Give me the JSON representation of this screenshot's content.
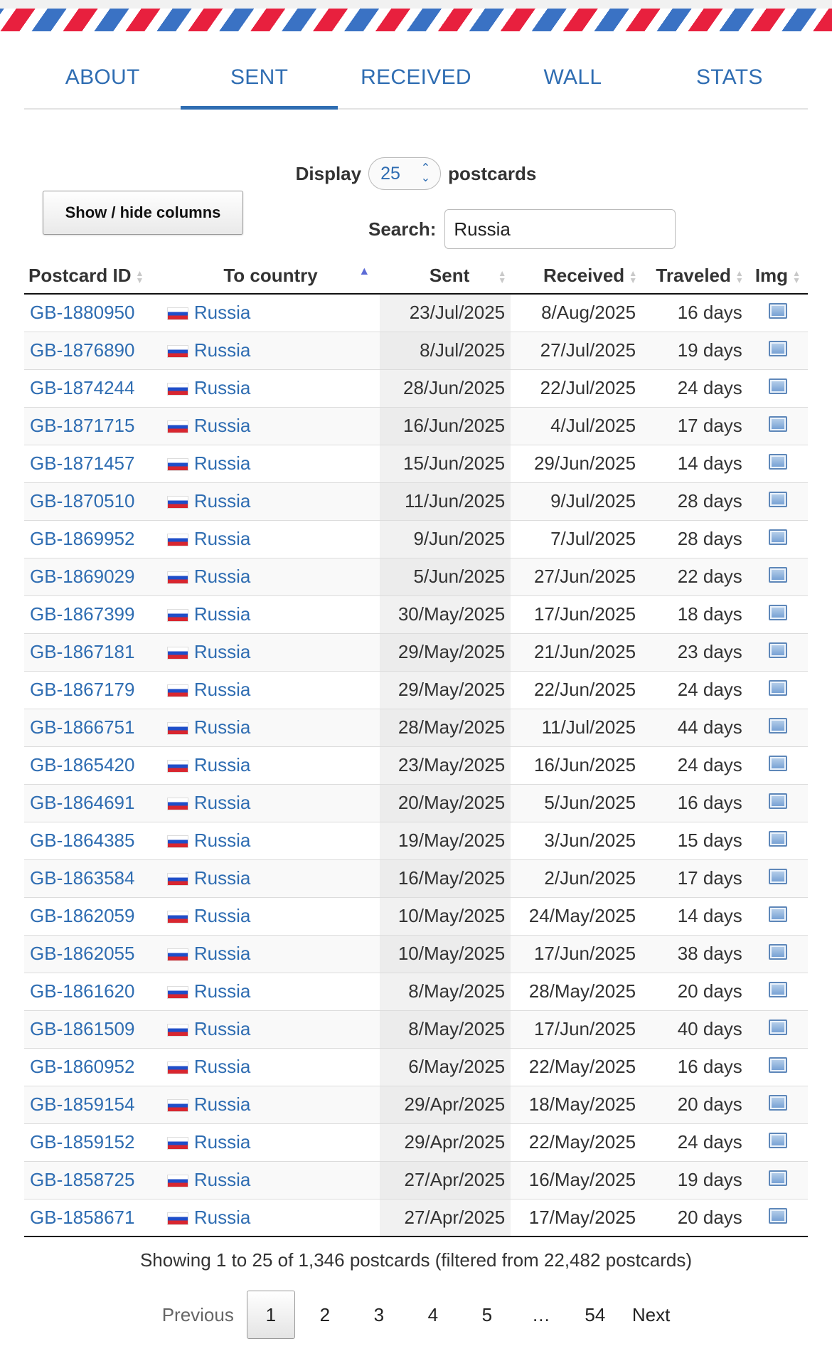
{
  "tabs": [
    {
      "label": "ABOUT"
    },
    {
      "label": "SENT"
    },
    {
      "label": "RECEIVED"
    },
    {
      "label": "WALL"
    },
    {
      "label": "STATS"
    }
  ],
  "display": {
    "prefix": "Display",
    "value": "25",
    "suffix": "postcards"
  },
  "columns_button": "Show / hide columns",
  "search": {
    "label": "Search:",
    "value": "Russia"
  },
  "table": {
    "headers": [
      "Postcard ID",
      "To country",
      "Sent",
      "Received",
      "Traveled",
      "Img"
    ],
    "rows": [
      {
        "id": "GB-1880950",
        "country": "Russia",
        "sent": "23/Jul/2025",
        "received": "8/Aug/2025",
        "traveled": "16 days"
      },
      {
        "id": "GB-1876890",
        "country": "Russia",
        "sent": "8/Jul/2025",
        "received": "27/Jul/2025",
        "traveled": "19 days"
      },
      {
        "id": "GB-1874244",
        "country": "Russia",
        "sent": "28/Jun/2025",
        "received": "22/Jul/2025",
        "traveled": "24 days"
      },
      {
        "id": "GB-1871715",
        "country": "Russia",
        "sent": "16/Jun/2025",
        "received": "4/Jul/2025",
        "traveled": "17 days"
      },
      {
        "id": "GB-1871457",
        "country": "Russia",
        "sent": "15/Jun/2025",
        "received": "29/Jun/2025",
        "traveled": "14 days"
      },
      {
        "id": "GB-1870510",
        "country": "Russia",
        "sent": "11/Jun/2025",
        "received": "9/Jul/2025",
        "traveled": "28 days"
      },
      {
        "id": "GB-1869952",
        "country": "Russia",
        "sent": "9/Jun/2025",
        "received": "7/Jul/2025",
        "traveled": "28 days"
      },
      {
        "id": "GB-1869029",
        "country": "Russia",
        "sent": "5/Jun/2025",
        "received": "27/Jun/2025",
        "traveled": "22 days"
      },
      {
        "id": "GB-1867399",
        "country": "Russia",
        "sent": "30/May/2025",
        "received": "17/Jun/2025",
        "traveled": "18 days"
      },
      {
        "id": "GB-1867181",
        "country": "Russia",
        "sent": "29/May/2025",
        "received": "21/Jun/2025",
        "traveled": "23 days"
      },
      {
        "id": "GB-1867179",
        "country": "Russia",
        "sent": "29/May/2025",
        "received": "22/Jun/2025",
        "traveled": "24 days"
      },
      {
        "id": "GB-1866751",
        "country": "Russia",
        "sent": "28/May/2025",
        "received": "11/Jul/2025",
        "traveled": "44 days"
      },
      {
        "id": "GB-1865420",
        "country": "Russia",
        "sent": "23/May/2025",
        "received": "16/Jun/2025",
        "traveled": "24 days"
      },
      {
        "id": "GB-1864691",
        "country": "Russia",
        "sent": "20/May/2025",
        "received": "5/Jun/2025",
        "traveled": "16 days"
      },
      {
        "id": "GB-1864385",
        "country": "Russia",
        "sent": "19/May/2025",
        "received": "3/Jun/2025",
        "traveled": "15 days"
      },
      {
        "id": "GB-1863584",
        "country": "Russia",
        "sent": "16/May/2025",
        "received": "2/Jun/2025",
        "traveled": "17 days"
      },
      {
        "id": "GB-1862059",
        "country": "Russia",
        "sent": "10/May/2025",
        "received": "24/May/2025",
        "traveled": "14 days"
      },
      {
        "id": "GB-1862055",
        "country": "Russia",
        "sent": "10/May/2025",
        "received": "17/Jun/2025",
        "traveled": "38 days"
      },
      {
        "id": "GB-1861620",
        "country": "Russia",
        "sent": "8/May/2025",
        "received": "28/May/2025",
        "traveled": "20 days"
      },
      {
        "id": "GB-1861509",
        "country": "Russia",
        "sent": "8/May/2025",
        "received": "17/Jun/2025",
        "traveled": "40 days"
      },
      {
        "id": "GB-1860952",
        "country": "Russia",
        "sent": "6/May/2025",
        "received": "22/May/2025",
        "traveled": "16 days"
      },
      {
        "id": "GB-1859154",
        "country": "Russia",
        "sent": "29/Apr/2025",
        "received": "18/May/2025",
        "traveled": "20 days"
      },
      {
        "id": "GB-1859152",
        "country": "Russia",
        "sent": "29/Apr/2025",
        "received": "22/May/2025",
        "traveled": "24 days"
      },
      {
        "id": "GB-1858725",
        "country": "Russia",
        "sent": "27/Apr/2025",
        "received": "16/May/2025",
        "traveled": "19 days"
      },
      {
        "id": "GB-1858671",
        "country": "Russia",
        "sent": "27/Apr/2025",
        "received": "17/May/2025",
        "traveled": "20 days"
      }
    ]
  },
  "info": "Showing 1 to 25 of 1,346 postcards (filtered from 22,482 postcards)",
  "pagination": {
    "previous": "Previous",
    "pages": [
      "1",
      "2",
      "3",
      "4",
      "5",
      "…",
      "54"
    ],
    "next": "Next"
  },
  "colors": {
    "link": "#2f6db2",
    "airmail_red": "#e8203e",
    "airmail_blue": "#3a72c4",
    "flag_white": "#ffffff",
    "flag_blue": "#1f4ec9",
    "flag_red": "#d8262f"
  },
  "icons": {
    "flag": "russia-flag-icon",
    "image": "postcard-image-icon",
    "sort": "sort-arrows-icon",
    "sort_asc": "sort-ascending-icon",
    "select": "select-chevron-icon"
  }
}
